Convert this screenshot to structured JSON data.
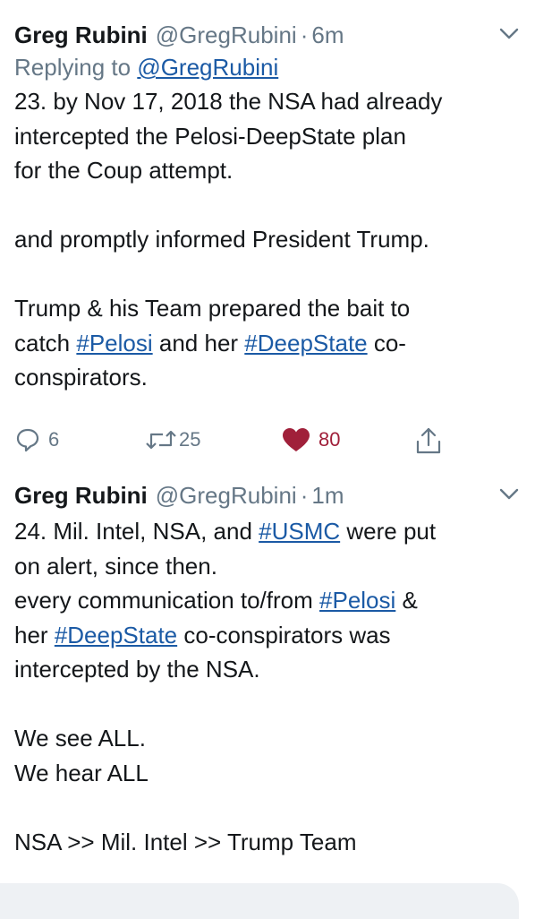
{
  "tweets": [
    {
      "name": "Greg Rubini",
      "handle": "@GregRubini",
      "separator": "·",
      "time": "6m",
      "replying_prefix": "Replying to",
      "replying_handle": "@GregRubini",
      "lines": {
        "l1": "23. by Nov 17, 2018 the NSA had already",
        "l2": "intercepted the Pelosi-DeepState plan",
        "l3": "for the Coup attempt.",
        "l4": "and promptly informed President Trump.",
        "l5": "Trump & his Team prepared the bait to",
        "l6_pre": "catch ",
        "l6_tag1": "#Pelosi",
        "l6_mid": " and her ",
        "l6_tag2": "#DeepState",
        "l6_post": " co-",
        "l7": "conspirators."
      },
      "actions": {
        "replies": "6",
        "retweets": "25",
        "likes": "80"
      },
      "icons": {
        "reply": "reply-icon",
        "retweet": "retweet-icon",
        "like": "heart-icon",
        "share": "share-icon",
        "menu": "chevron-down-icon"
      }
    },
    {
      "name": "Greg Rubini",
      "handle": "@GregRubini",
      "separator": "·",
      "time": "1m",
      "lines": {
        "l1_pre": "24. Mil. Intel, NSA, and ",
        "l1_tag": "#USMC",
        "l1_post": " were put",
        "l2": "on alert, since then.",
        "l3_pre": "every communication to/from ",
        "l3_tag": "#Pelosi",
        "l3_post": " &",
        "l4_pre": "her ",
        "l4_tag": "#DeepState",
        "l4_post": " co-conspirators was",
        "l5": "intercepted by the NSA.",
        "l6": "We see ALL.",
        "l7": "We hear ALL",
        "l8": "NSA >> Mil. Intel >> Trump Team"
      }
    }
  ],
  "colors": {
    "text": "#14171a",
    "secondary": "#657786",
    "link": "#1b5aa5",
    "like": "#a0203a"
  }
}
